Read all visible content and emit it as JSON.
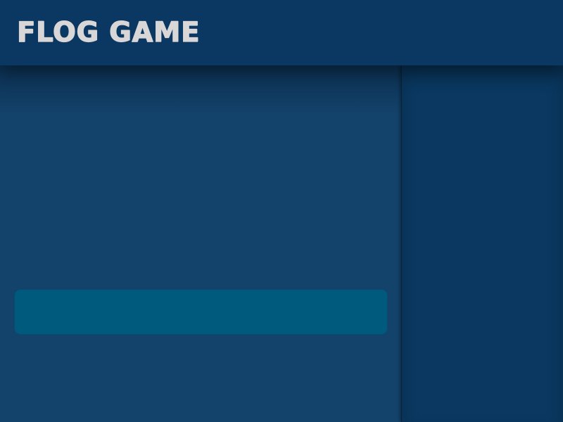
{
  "header": {
    "title": "FLOG GAME"
  },
  "colors": {
    "page_background": "#13426b",
    "header_background": "#0b3862",
    "title_text": "#d8d6d6",
    "main_panel": "#13426b",
    "side_panel": "#0a3860",
    "game_bar": "#005a7d"
  }
}
